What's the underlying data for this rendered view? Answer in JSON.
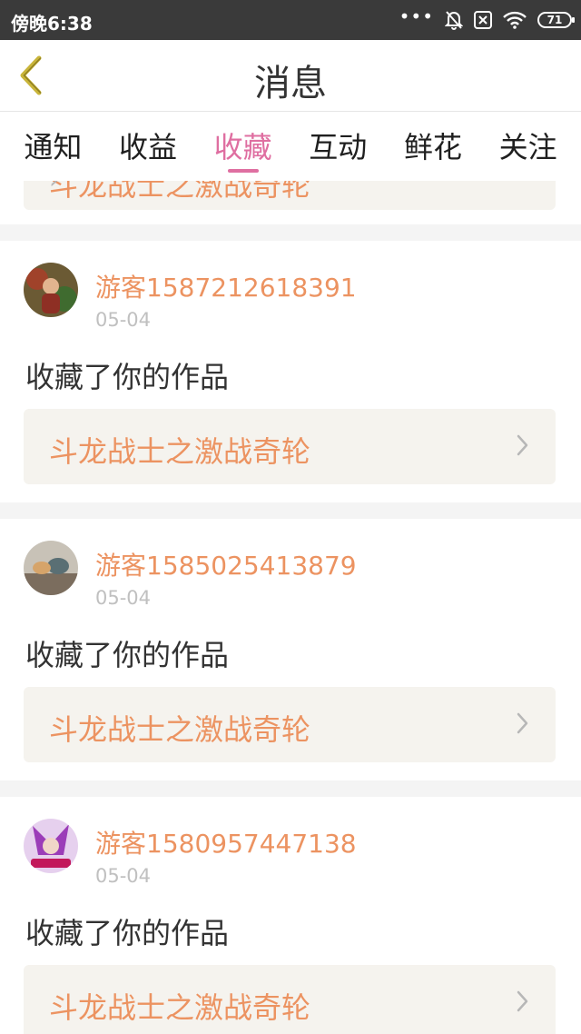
{
  "status_bar": {
    "time": "傍晚6:38",
    "more_icon": "more-dots-icon",
    "notification_icon": "bell-off-icon",
    "sim_icon": "sim-card-icon",
    "wifi_icon": "wifi-icon",
    "battery_level": "71"
  },
  "header": {
    "title": "消息",
    "back_icon": "chevron-left-icon"
  },
  "tabs": [
    {
      "label": "通知",
      "active": false
    },
    {
      "label": "收益",
      "active": false
    },
    {
      "label": "收藏",
      "active": true
    },
    {
      "label": "互动",
      "active": false
    },
    {
      "label": "鲜花",
      "active": false
    },
    {
      "label": "关注",
      "active": false
    }
  ],
  "partial_item": {
    "title": "斗龙战士之激战奇轮"
  },
  "notifications": [
    {
      "user": "游客1587212618391",
      "date": "05-04",
      "action": "收藏了你的作品",
      "work_title": "斗龙战士之激战奇轮",
      "avatar_colors": [
        "#6b5a34",
        "#a0422a",
        "#3f6b2f"
      ]
    },
    {
      "user": "游客1585025413879",
      "date": "05-04",
      "action": "收藏了你的作品",
      "work_title": "斗龙战士之激战奇轮",
      "avatar_colors": [
        "#c8c2b7",
        "#7b6d5e",
        "#5a6f74"
      ]
    },
    {
      "user": "游客1580957447138",
      "date": "05-04",
      "action": "收藏了你的作品",
      "work_title": "斗龙战士之激战奇轮",
      "avatar_colors": [
        "#9b3db8",
        "#e6d0ee",
        "#c2185b"
      ]
    }
  ],
  "colors": {
    "accent_pink": "#df6fa1",
    "accent_orange": "#ec9361",
    "card_bg": "#f5f3ee"
  }
}
